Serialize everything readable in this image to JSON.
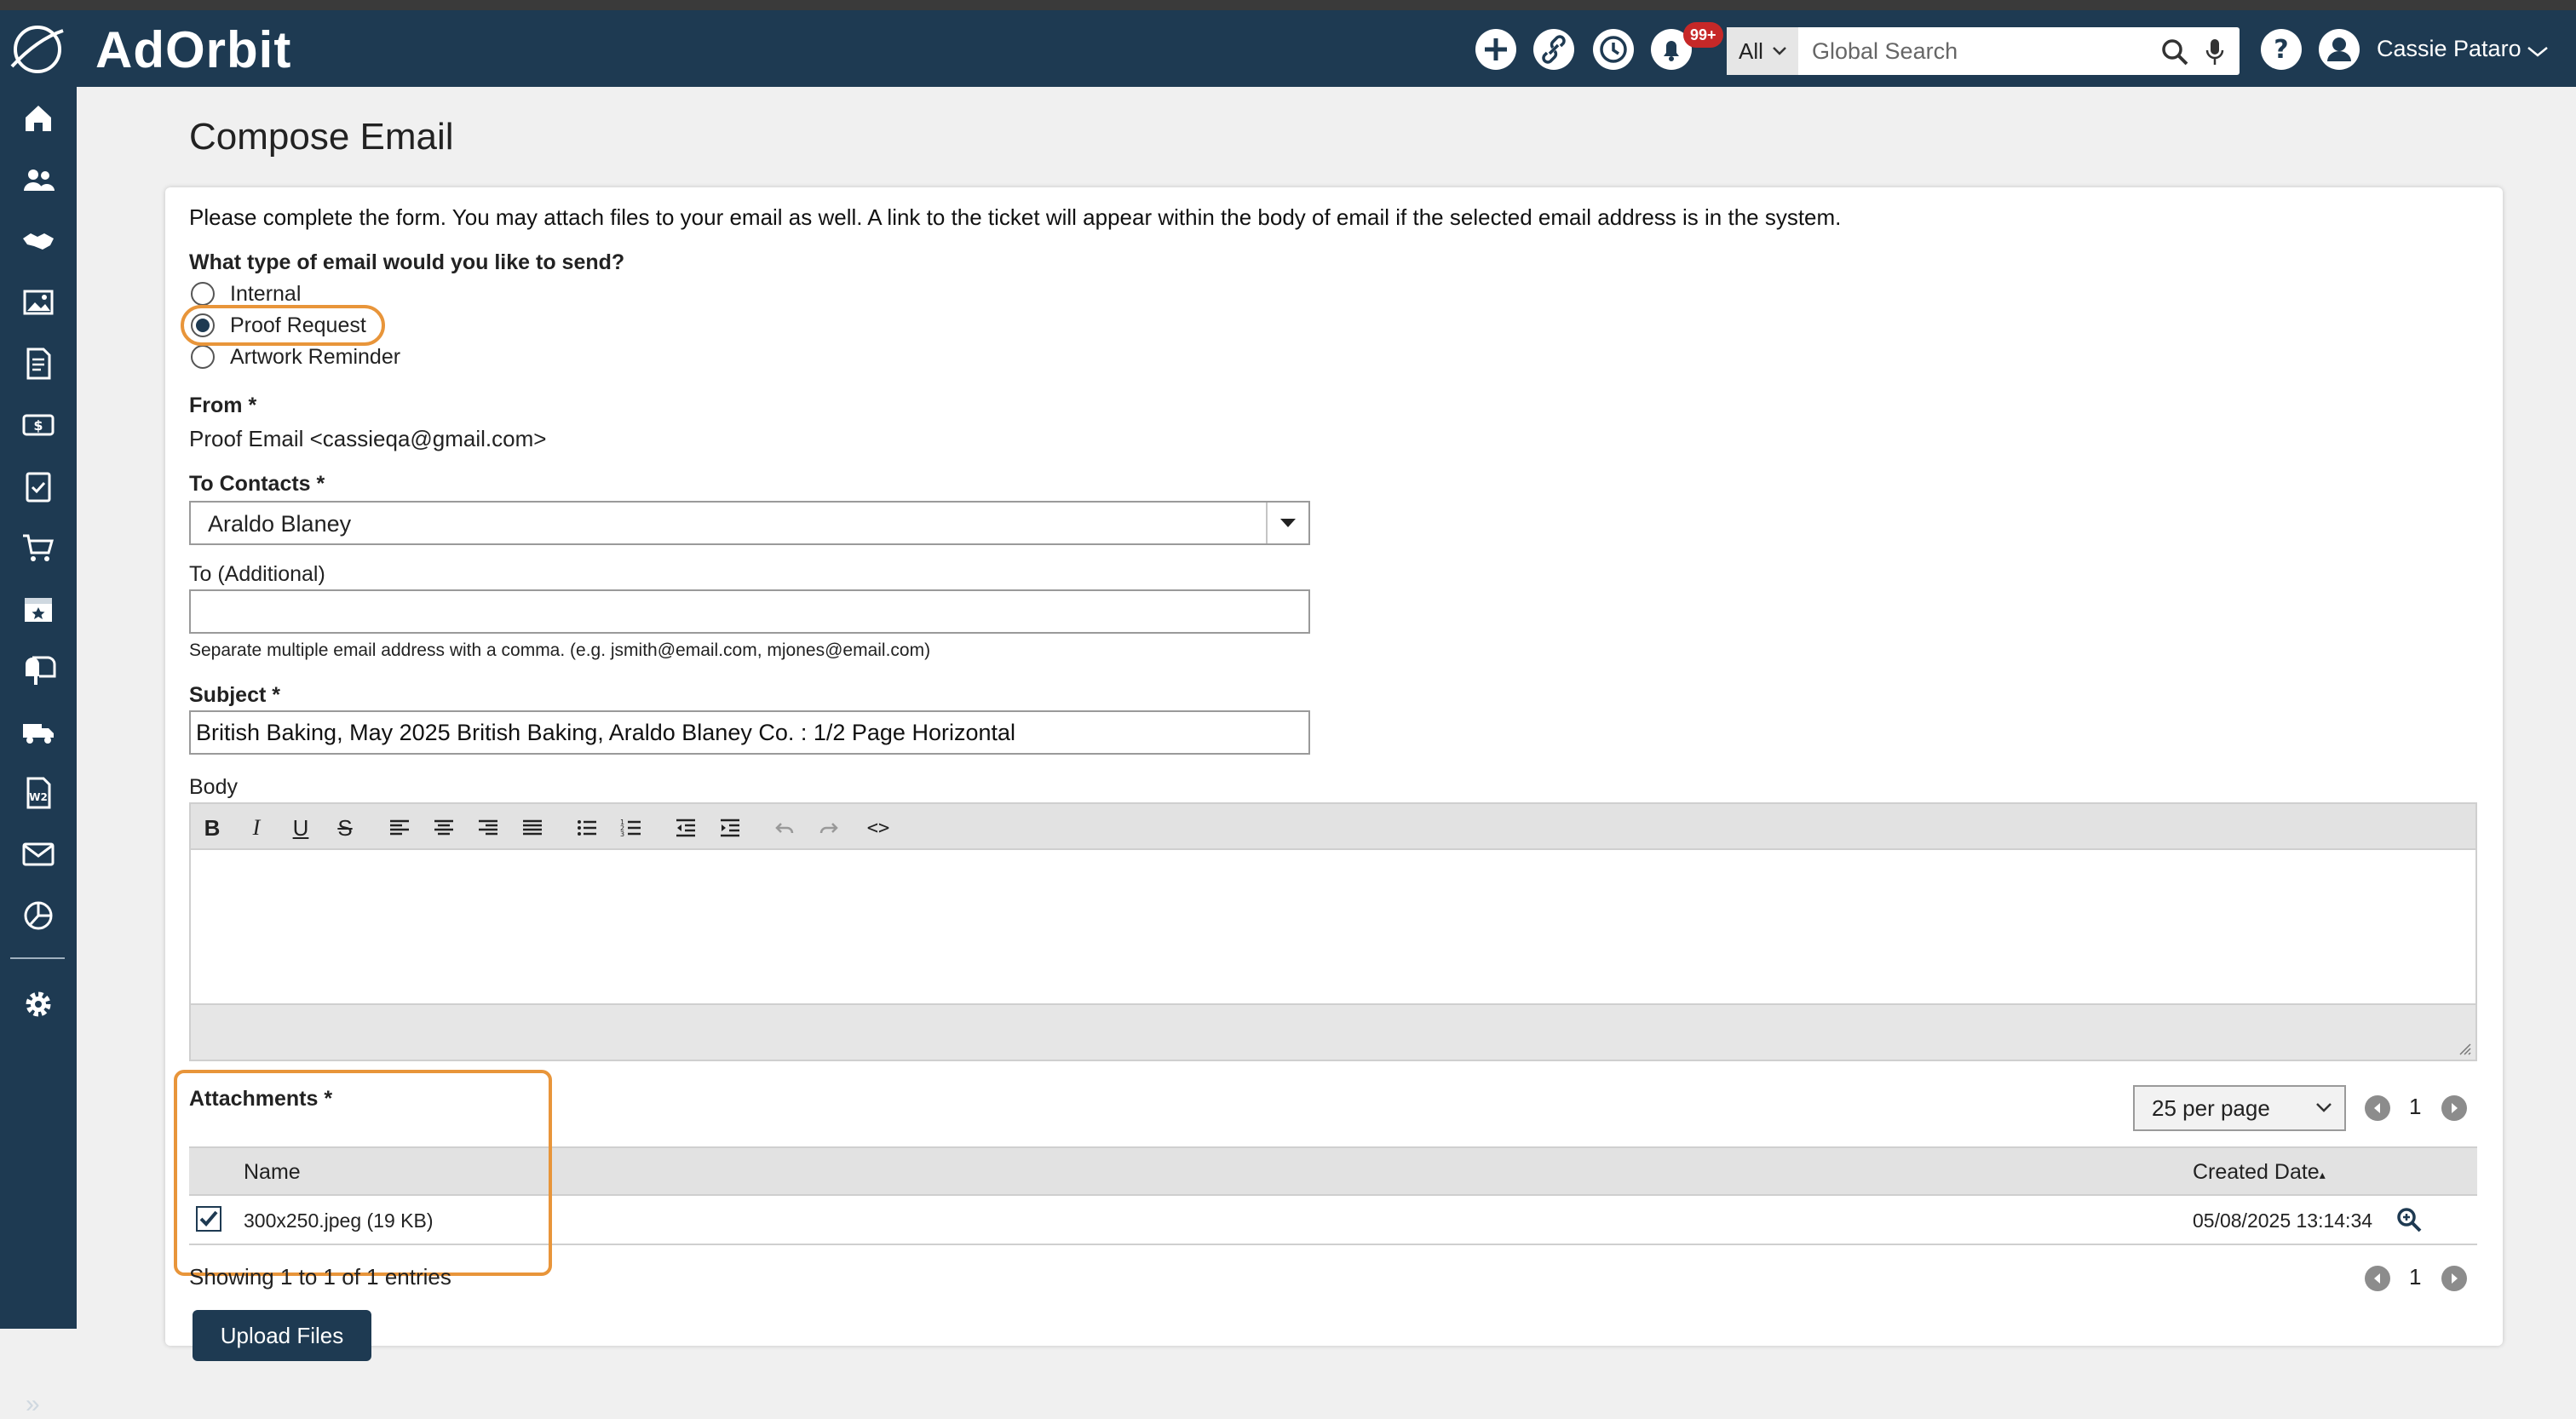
{
  "app": {
    "logo_text": "AdOrbit",
    "notification_count": "99+",
    "search": {
      "scope": "All",
      "placeholder": "Global Search"
    },
    "user_name": "Cassie Pataro",
    "accent_color": "#1e3a52",
    "highlight_color": "#e8953a"
  },
  "sidebar": {
    "items": [
      "home-icon",
      "contacts-icon",
      "handshake-icon",
      "media-icon",
      "invoice-icon",
      "billing-icon",
      "tasks-icon",
      "cart-icon",
      "calendar-icon",
      "mailbox-icon",
      "delivery-icon",
      "w2-icon",
      "email-icon",
      "reports-icon",
      "settings-icon"
    ],
    "collapse_label": "»"
  },
  "page": {
    "title": "Compose Email",
    "intro": "Please complete the form. You may attach files to your email as well. A link to the ticket will appear within the body of email if the selected email address is in the system."
  },
  "email_type": {
    "question": "What type of email would you like to send?",
    "options": [
      "Internal",
      "Proof Request",
      "Artwork Reminder"
    ],
    "selected": "Proof Request"
  },
  "from": {
    "label": "From *",
    "value": "Proof Email <cassieqa@gmail.com>"
  },
  "to_contacts": {
    "label": "To Contacts *",
    "value": "Araldo Blaney"
  },
  "to_additional": {
    "label": "To (Additional)",
    "value": "",
    "help": "Separate multiple email address with a comma. (e.g. jsmith@email.com, mjones@email.com)"
  },
  "subject": {
    "label": "Subject *",
    "value": "British Baking, May 2025 British Baking, Araldo Blaney Co. : 1/2 Page Horizontal"
  },
  "body": {
    "label": "Body",
    "toolbar": [
      "B",
      "I",
      "U",
      "S",
      "align-left",
      "align-center",
      "align-right",
      "align-justify",
      "bullet-list",
      "numbered-list",
      "outdent",
      "indent",
      "undo",
      "redo",
      "<>"
    ]
  },
  "attachments": {
    "label": "Attachments *",
    "per_page": "25 per page",
    "page": "1",
    "columns": [
      "Name",
      "Created Date"
    ],
    "sort_indicator": "▴",
    "rows": [
      {
        "checked": true,
        "name": "300x250.jpeg (19 KB)",
        "created": "05/08/2025 13:14:34"
      }
    ],
    "showing": "Showing 1 to 1 of 1 entries",
    "upload_label": "Upload Files"
  }
}
